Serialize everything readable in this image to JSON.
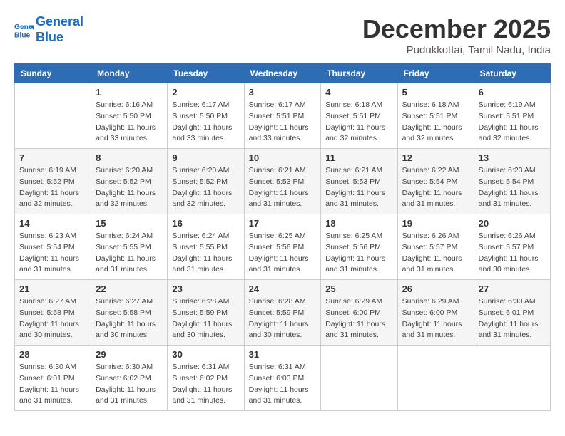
{
  "header": {
    "logo_line1": "General",
    "logo_line2": "Blue",
    "month_title": "December 2025",
    "subtitle": "Pudukkottai, Tamil Nadu, India"
  },
  "weekdays": [
    "Sunday",
    "Monday",
    "Tuesday",
    "Wednesday",
    "Thursday",
    "Friday",
    "Saturday"
  ],
  "weeks": [
    [
      {
        "day": "",
        "info": ""
      },
      {
        "day": "1",
        "info": "Sunrise: 6:16 AM\nSunset: 5:50 PM\nDaylight: 11 hours\nand 33 minutes."
      },
      {
        "day": "2",
        "info": "Sunrise: 6:17 AM\nSunset: 5:50 PM\nDaylight: 11 hours\nand 33 minutes."
      },
      {
        "day": "3",
        "info": "Sunrise: 6:17 AM\nSunset: 5:51 PM\nDaylight: 11 hours\nand 33 minutes."
      },
      {
        "day": "4",
        "info": "Sunrise: 6:18 AM\nSunset: 5:51 PM\nDaylight: 11 hours\nand 32 minutes."
      },
      {
        "day": "5",
        "info": "Sunrise: 6:18 AM\nSunset: 5:51 PM\nDaylight: 11 hours\nand 32 minutes."
      },
      {
        "day": "6",
        "info": "Sunrise: 6:19 AM\nSunset: 5:51 PM\nDaylight: 11 hours\nand 32 minutes."
      }
    ],
    [
      {
        "day": "7",
        "info": "Sunrise: 6:19 AM\nSunset: 5:52 PM\nDaylight: 11 hours\nand 32 minutes."
      },
      {
        "day": "8",
        "info": "Sunrise: 6:20 AM\nSunset: 5:52 PM\nDaylight: 11 hours\nand 32 minutes."
      },
      {
        "day": "9",
        "info": "Sunrise: 6:20 AM\nSunset: 5:52 PM\nDaylight: 11 hours\nand 32 minutes."
      },
      {
        "day": "10",
        "info": "Sunrise: 6:21 AM\nSunset: 5:53 PM\nDaylight: 11 hours\nand 31 minutes."
      },
      {
        "day": "11",
        "info": "Sunrise: 6:21 AM\nSunset: 5:53 PM\nDaylight: 11 hours\nand 31 minutes."
      },
      {
        "day": "12",
        "info": "Sunrise: 6:22 AM\nSunset: 5:54 PM\nDaylight: 11 hours\nand 31 minutes."
      },
      {
        "day": "13",
        "info": "Sunrise: 6:23 AM\nSunset: 5:54 PM\nDaylight: 11 hours\nand 31 minutes."
      }
    ],
    [
      {
        "day": "14",
        "info": "Sunrise: 6:23 AM\nSunset: 5:54 PM\nDaylight: 11 hours\nand 31 minutes."
      },
      {
        "day": "15",
        "info": "Sunrise: 6:24 AM\nSunset: 5:55 PM\nDaylight: 11 hours\nand 31 minutes."
      },
      {
        "day": "16",
        "info": "Sunrise: 6:24 AM\nSunset: 5:55 PM\nDaylight: 11 hours\nand 31 minutes."
      },
      {
        "day": "17",
        "info": "Sunrise: 6:25 AM\nSunset: 5:56 PM\nDaylight: 11 hours\nand 31 minutes."
      },
      {
        "day": "18",
        "info": "Sunrise: 6:25 AM\nSunset: 5:56 PM\nDaylight: 11 hours\nand 31 minutes."
      },
      {
        "day": "19",
        "info": "Sunrise: 6:26 AM\nSunset: 5:57 PM\nDaylight: 11 hours\nand 31 minutes."
      },
      {
        "day": "20",
        "info": "Sunrise: 6:26 AM\nSunset: 5:57 PM\nDaylight: 11 hours\nand 30 minutes."
      }
    ],
    [
      {
        "day": "21",
        "info": "Sunrise: 6:27 AM\nSunset: 5:58 PM\nDaylight: 11 hours\nand 30 minutes."
      },
      {
        "day": "22",
        "info": "Sunrise: 6:27 AM\nSunset: 5:58 PM\nDaylight: 11 hours\nand 30 minutes."
      },
      {
        "day": "23",
        "info": "Sunrise: 6:28 AM\nSunset: 5:59 PM\nDaylight: 11 hours\nand 30 minutes."
      },
      {
        "day": "24",
        "info": "Sunrise: 6:28 AM\nSunset: 5:59 PM\nDaylight: 11 hours\nand 30 minutes."
      },
      {
        "day": "25",
        "info": "Sunrise: 6:29 AM\nSunset: 6:00 PM\nDaylight: 11 hours\nand 31 minutes."
      },
      {
        "day": "26",
        "info": "Sunrise: 6:29 AM\nSunset: 6:00 PM\nDaylight: 11 hours\nand 31 minutes."
      },
      {
        "day": "27",
        "info": "Sunrise: 6:30 AM\nSunset: 6:01 PM\nDaylight: 11 hours\nand 31 minutes."
      }
    ],
    [
      {
        "day": "28",
        "info": "Sunrise: 6:30 AM\nSunset: 6:01 PM\nDaylight: 11 hours\nand 31 minutes."
      },
      {
        "day": "29",
        "info": "Sunrise: 6:30 AM\nSunset: 6:02 PM\nDaylight: 11 hours\nand 31 minutes."
      },
      {
        "day": "30",
        "info": "Sunrise: 6:31 AM\nSunset: 6:02 PM\nDaylight: 11 hours\nand 31 minutes."
      },
      {
        "day": "31",
        "info": "Sunrise: 6:31 AM\nSunset: 6:03 PM\nDaylight: 11 hours\nand 31 minutes."
      },
      {
        "day": "",
        "info": ""
      },
      {
        "day": "",
        "info": ""
      },
      {
        "day": "",
        "info": ""
      }
    ]
  ]
}
